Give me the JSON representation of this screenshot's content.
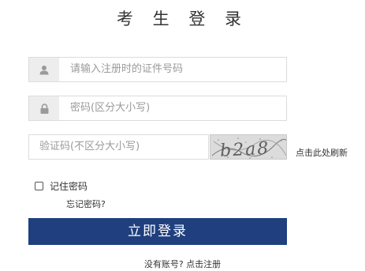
{
  "page": {
    "title": "考 生 登 录"
  },
  "form": {
    "id_field": {
      "placeholder": "请输入注册时的证件号码",
      "icon": "user-icon"
    },
    "password_field": {
      "placeholder": "密码(区分大小写)",
      "icon": "lock-icon"
    },
    "captcha_field": {
      "placeholder": "验证码(不区分大小写)"
    },
    "captcha_image": {
      "text": "b2a8"
    },
    "refresh_link": "点击此处刷新",
    "remember_label": "记住密码",
    "remember_checked": false,
    "forgot_link": "忘记密码?",
    "submit_label": "立即登录",
    "register_link": "没有账号? 点击注册"
  },
  "colors": {
    "primary_button": "#1f3f7e",
    "icon_background": "#ededed",
    "field_border": "#dcdcdc",
    "placeholder_text": "#9a9a9a"
  }
}
